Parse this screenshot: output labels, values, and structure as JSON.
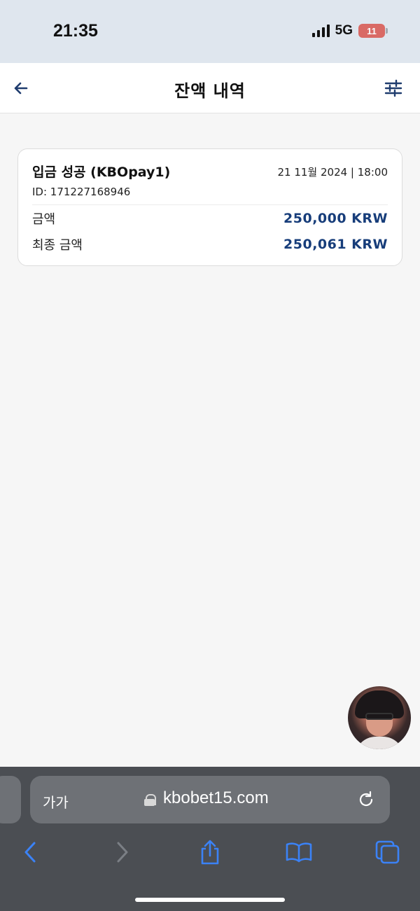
{
  "status_bar": {
    "time": "21:35",
    "network": "5G",
    "battery": "11"
  },
  "header": {
    "back_icon": "arrow-left-icon",
    "title": "잔액 내역",
    "filter_icon": "sliders-icon"
  },
  "transaction": {
    "title": "입금 성공 (KBOpay1)",
    "datetime": "21 11월 2024 | 18:00",
    "id": "ID: 171227168946",
    "amount_label": "금액",
    "amount_value": "250,000 KRW",
    "final_amount_label": "최종 금액",
    "final_amount_value": "250,061 KRW"
  },
  "browser": {
    "text_size_label": "가가",
    "url": "kbobet15.com",
    "icons": [
      "lock-icon",
      "reload-icon",
      "back-icon",
      "forward-icon",
      "share-icon",
      "bookmarks-icon",
      "tabs-icon"
    ]
  },
  "colors": {
    "accent_blue": "#173d7a",
    "safari_blue": "#3b82f6",
    "status_bar_bg": "#dfe6ee"
  }
}
